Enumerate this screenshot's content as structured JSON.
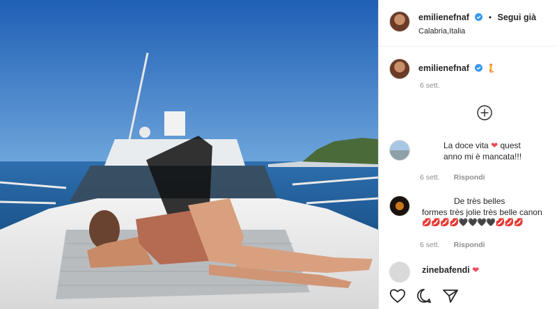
{
  "header": {
    "username": "emilienefnaf",
    "follow_label": "Segui già",
    "location": "Calabria,Italia"
  },
  "caption": {
    "username": "emilienefnaf",
    "emoji": "🧜",
    "time": "6 sett."
  },
  "comments": [
    {
      "line1": "La doce vita",
      "line1b": "quest",
      "line2": "anno mi è mancata!!!",
      "time": "6 sett.",
      "reply": "Rispondi"
    },
    {
      "line1": "De très belles",
      "line2": "formes très jolie très belle canon",
      "line3": "💋💋💋💋🖤🖤🖤🖤💋💋💋",
      "time": "6 sett.",
      "reply": "Rispondi"
    },
    {
      "username": "zinebafendi",
      "heart": "❤"
    }
  ],
  "colors": {
    "verified": "#3897f0",
    "heart": "#ed4956",
    "muted": "#8e8e8e",
    "text": "#262626"
  },
  "icons": [
    "heart-icon",
    "comment-icon",
    "share-icon",
    "add-comment-icon",
    "verified-icon"
  ]
}
